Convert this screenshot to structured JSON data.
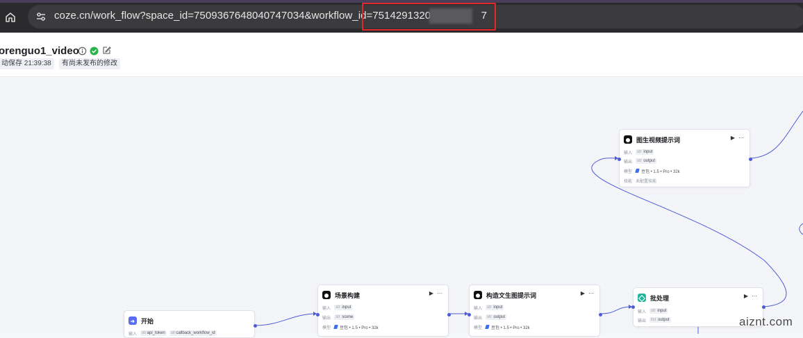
{
  "browser": {
    "url": "coze.cn/work_flow?space_id=7509367648040747034&workflow_id=75142913205",
    "url_tail": "7"
  },
  "header": {
    "title": "orenguo1_video",
    "autosave": "动保存 21:39:38",
    "unpublished": "有尚未发布的修改"
  },
  "nodes": {
    "start": {
      "title": "开始",
      "input_label": "输入",
      "params": [
        "api_token",
        "callback_workflow_id"
      ]
    },
    "scene": {
      "title": "场景构建",
      "rows": [
        {
          "label": "输入",
          "type": "str",
          "name": "input"
        },
        {
          "label": "输出",
          "type": "str",
          "name": "scene"
        }
      ],
      "model_label": "模型",
      "model": "豆包 • 1.5 • Pro • 32k"
    },
    "t2i": {
      "title": "构造文生图提示词",
      "rows": [
        {
          "label": "输入",
          "type": "str",
          "name": "input"
        },
        {
          "label": "输出",
          "type": "str",
          "name": "output"
        }
      ],
      "model_label": "模型",
      "model": "豆包 • 1.5 • Pro • 32k"
    },
    "batch": {
      "title": "批处理",
      "rows": [
        {
          "label": "输入",
          "type": "str",
          "name": "input"
        },
        {
          "label": "输出",
          "type": "list",
          "name": "output"
        }
      ]
    },
    "i2v": {
      "title": "图生视频提示词",
      "rows": [
        {
          "label": "输入",
          "type": "str",
          "name": "input"
        },
        {
          "label": "输出",
          "type": "str",
          "name": "output"
        }
      ],
      "model_label": "模型",
      "model": "豆包 • 1.5 • Pro • 32k",
      "skill_label": "技能",
      "skill": "未配置技能"
    }
  },
  "icons": {
    "run": "▶",
    "more": "···"
  },
  "watermark": "aiznt.com"
}
